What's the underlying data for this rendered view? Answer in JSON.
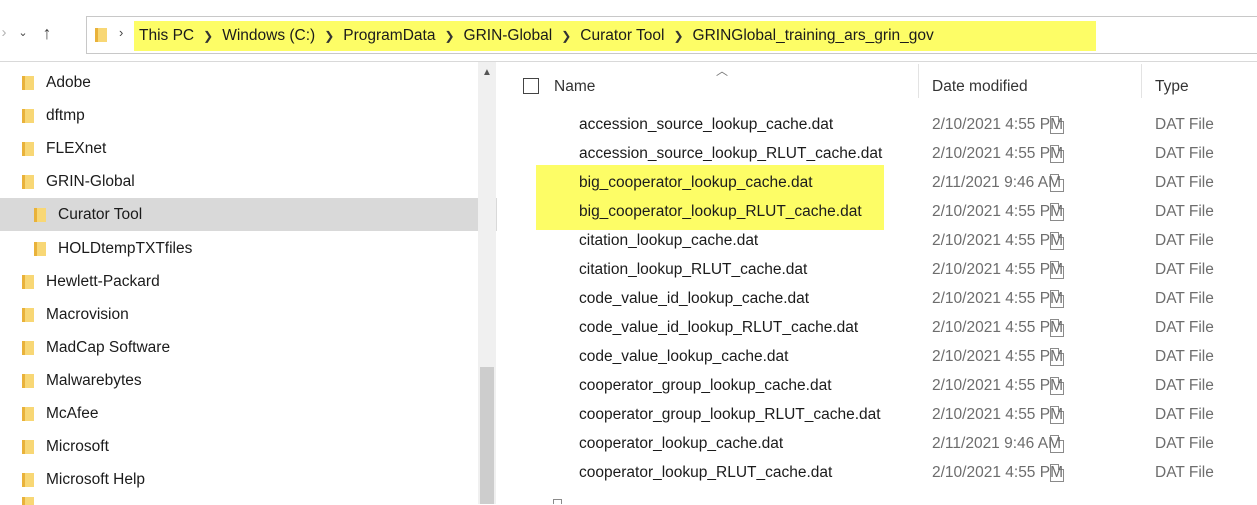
{
  "address_bar": {
    "breadcrumbs": [
      "This PC",
      "Windows (C:)",
      "ProgramData",
      "GRIN-Global",
      "Curator Tool",
      "GRINGlobal_training_ars_grin_gov"
    ],
    "highlight_color": "#fdfd66"
  },
  "navigation_icons": [
    "back-arrow-icon",
    "recent-locations-chevron-icon",
    "up-arrow-icon",
    "folder-icon"
  ],
  "nav_pane": {
    "items": [
      {
        "label": "Adobe"
      },
      {
        "label": "dftmp"
      },
      {
        "label": "FLEXnet"
      },
      {
        "label": "GRIN-Global"
      },
      {
        "label": "Curator Tool",
        "selected": true
      },
      {
        "label": "HOLDtempTXTfiles"
      },
      {
        "label": "Hewlett-Packard"
      },
      {
        "label": "Macrovision"
      },
      {
        "label": "MadCap Software"
      },
      {
        "label": "Malwarebytes"
      },
      {
        "label": "McAfee"
      },
      {
        "label": "Microsoft"
      },
      {
        "label": "Microsoft Help"
      }
    ]
  },
  "file_list": {
    "columns": {
      "name": "Name",
      "date": "Date modified",
      "type": "Type"
    },
    "rows": [
      {
        "name": "accession_source_lookup_cache.dat",
        "date": "2/10/2021 4:55 PM",
        "type": "DAT File"
      },
      {
        "name": "accession_source_lookup_RLUT_cache.dat",
        "date": "2/10/2021 4:55 PM",
        "type": "DAT File"
      },
      {
        "name": "big_cooperator_lookup_cache.dat",
        "date": "2/11/2021 9:46 AM",
        "type": "DAT File",
        "highlighted": true
      },
      {
        "name": "big_cooperator_lookup_RLUT_cache.dat",
        "date": "2/10/2021 4:55 PM",
        "type": "DAT File",
        "highlighted": true
      },
      {
        "name": "citation_lookup_cache.dat",
        "date": "2/10/2021 4:55 PM",
        "type": "DAT File"
      },
      {
        "name": "citation_lookup_RLUT_cache.dat",
        "date": "2/10/2021 4:55 PM",
        "type": "DAT File"
      },
      {
        "name": "code_value_id_lookup_cache.dat",
        "date": "2/10/2021 4:55 PM",
        "type": "DAT File"
      },
      {
        "name": "code_value_id_lookup_RLUT_cache.dat",
        "date": "2/10/2021 4:55 PM",
        "type": "DAT File"
      },
      {
        "name": "code_value_lookup_cache.dat",
        "date": "2/10/2021 4:55 PM",
        "type": "DAT File"
      },
      {
        "name": "cooperator_group_lookup_cache.dat",
        "date": "2/10/2021 4:55 PM",
        "type": "DAT File"
      },
      {
        "name": "cooperator_group_lookup_RLUT_cache.dat",
        "date": "2/10/2021 4:55 PM",
        "type": "DAT File"
      },
      {
        "name": "cooperator_lookup_cache.dat",
        "date": "2/11/2021 9:46 AM",
        "type": "DAT File"
      },
      {
        "name": "cooperator_lookup_RLUT_cache.dat",
        "date": "2/10/2021 4:55 PM",
        "type": "DAT File"
      }
    ]
  }
}
